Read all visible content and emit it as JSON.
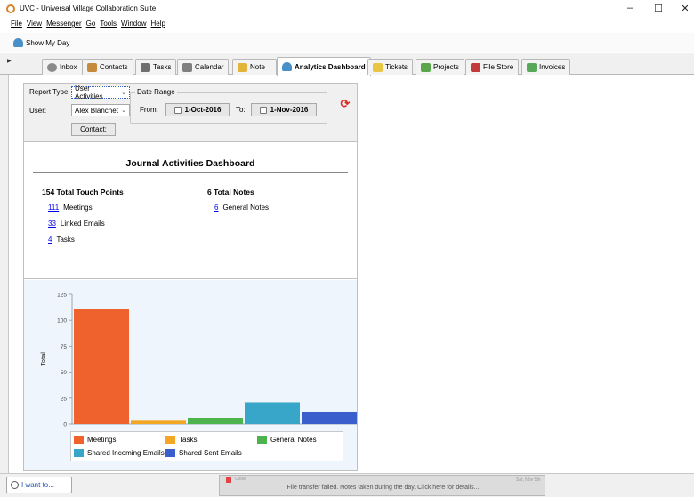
{
  "window": {
    "title": "UVC - Universal Village Collaboration Suite",
    "controls": [
      "–",
      "☐",
      "✕"
    ]
  },
  "menu": [
    "File",
    "View",
    "Messenger",
    "Go",
    "Tools",
    "Window",
    "Help"
  ],
  "toolbar": {
    "show_my_day": "Show My Day"
  },
  "tabs": [
    {
      "label": "Inbox",
      "icon": "inbox-icon",
      "color": "#8a8a8a"
    },
    {
      "label": "Contacts",
      "icon": "contacts-icon",
      "color": "#c58b3c"
    },
    {
      "label": "Tasks",
      "icon": "tasks-icon",
      "color": "#6f6f6f"
    },
    {
      "label": "Calendar",
      "icon": "calendar-icon",
      "color": "#7f7f7f"
    },
    {
      "label": "Note",
      "icon": "note-icon",
      "color": "#e2b53a"
    },
    {
      "label": "Analytics Dashboard",
      "icon": "analytics-icon",
      "color": "#4a90c8"
    },
    {
      "label": "Tickets",
      "icon": "tickets-icon",
      "color": "#e8c542"
    },
    {
      "label": "Projects",
      "icon": "projects-icon",
      "color": "#5aa64a"
    },
    {
      "label": "File Store",
      "icon": "file-store-icon",
      "color": "#c23a3a"
    },
    {
      "label": "Invoices",
      "icon": "invoices-icon",
      "color": "#58a85a"
    }
  ],
  "filters": {
    "report_type_label": "Report Type:",
    "report_type_value": "User Activities",
    "user_label": "User:",
    "user_value": "Alex Blanchet",
    "contact_button": "Contact:",
    "date_range_label": "Date Range",
    "from_label": "From:",
    "from_value": "1-Oct-2016",
    "to_label": "To:",
    "to_value": "1-Nov-2016"
  },
  "report": {
    "title": "Journal Activities Dashboard",
    "touch_points_title": "154 Total Touch Points",
    "touch_points": [
      {
        "count": "111",
        "label": "Meetings"
      },
      {
        "count": "33",
        "label": "Linked Emails"
      },
      {
        "count": "4",
        "label": "Tasks"
      }
    ],
    "notes_title": "6 Total Notes",
    "notes": [
      {
        "count": "6",
        "label": "General Notes"
      }
    ]
  },
  "chart_data": {
    "type": "bar",
    "ylabel": "Total",
    "xlabel": "",
    "ylim": [
      0,
      125
    ],
    "yticks": [
      "0",
      "25",
      "50",
      "75",
      "100",
      "125"
    ],
    "grid": false,
    "legend_position": "bottom",
    "series": [
      {
        "name": "Meetings",
        "value": 111,
        "color": "#f0622d"
      },
      {
        "name": "Tasks",
        "value": 4,
        "color": "#f2a624"
      },
      {
        "name": "General Notes",
        "value": 6,
        "color": "#4db34d"
      },
      {
        "name": "Shared Incoming Emails",
        "value": 21,
        "color": "#37a6c8"
      },
      {
        "name": "Shared Sent Emails",
        "value": 12,
        "color": "#3a5fcc"
      }
    ]
  },
  "status": {
    "i_want_to": "I want to...",
    "notification_header": "Close",
    "notification_text": "File transfer failed. Notes taken during the day. Click here for details...",
    "notification_side": "Sat, Nov 5th"
  }
}
